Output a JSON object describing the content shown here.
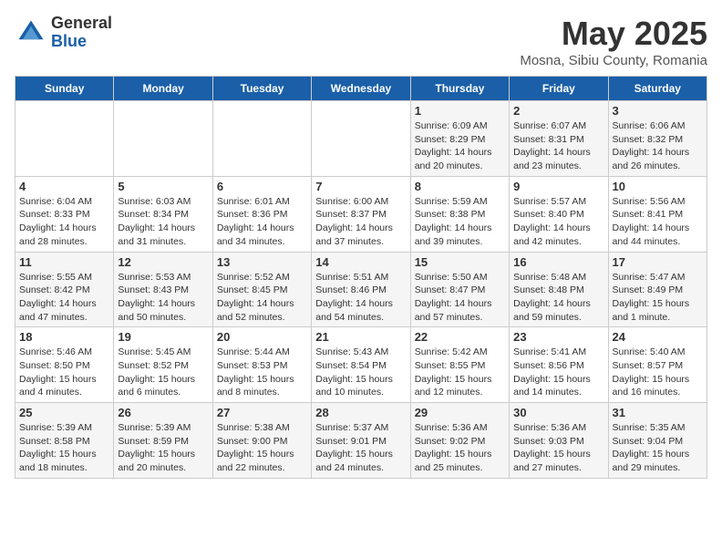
{
  "logo": {
    "general": "General",
    "blue": "Blue"
  },
  "title": "May 2025",
  "subtitle": "Mosna, Sibiu County, Romania",
  "days_of_week": [
    "Sunday",
    "Monday",
    "Tuesday",
    "Wednesday",
    "Thursday",
    "Friday",
    "Saturday"
  ],
  "weeks": [
    [
      {
        "day": "",
        "info": ""
      },
      {
        "day": "",
        "info": ""
      },
      {
        "day": "",
        "info": ""
      },
      {
        "day": "",
        "info": ""
      },
      {
        "day": "1",
        "info": "Sunrise: 6:09 AM\nSunset: 8:29 PM\nDaylight: 14 hours\nand 20 minutes."
      },
      {
        "day": "2",
        "info": "Sunrise: 6:07 AM\nSunset: 8:31 PM\nDaylight: 14 hours\nand 23 minutes."
      },
      {
        "day": "3",
        "info": "Sunrise: 6:06 AM\nSunset: 8:32 PM\nDaylight: 14 hours\nand 26 minutes."
      }
    ],
    [
      {
        "day": "4",
        "info": "Sunrise: 6:04 AM\nSunset: 8:33 PM\nDaylight: 14 hours\nand 28 minutes."
      },
      {
        "day": "5",
        "info": "Sunrise: 6:03 AM\nSunset: 8:34 PM\nDaylight: 14 hours\nand 31 minutes."
      },
      {
        "day": "6",
        "info": "Sunrise: 6:01 AM\nSunset: 8:36 PM\nDaylight: 14 hours\nand 34 minutes."
      },
      {
        "day": "7",
        "info": "Sunrise: 6:00 AM\nSunset: 8:37 PM\nDaylight: 14 hours\nand 37 minutes."
      },
      {
        "day": "8",
        "info": "Sunrise: 5:59 AM\nSunset: 8:38 PM\nDaylight: 14 hours\nand 39 minutes."
      },
      {
        "day": "9",
        "info": "Sunrise: 5:57 AM\nSunset: 8:40 PM\nDaylight: 14 hours\nand 42 minutes."
      },
      {
        "day": "10",
        "info": "Sunrise: 5:56 AM\nSunset: 8:41 PM\nDaylight: 14 hours\nand 44 minutes."
      }
    ],
    [
      {
        "day": "11",
        "info": "Sunrise: 5:55 AM\nSunset: 8:42 PM\nDaylight: 14 hours\nand 47 minutes."
      },
      {
        "day": "12",
        "info": "Sunrise: 5:53 AM\nSunset: 8:43 PM\nDaylight: 14 hours\nand 50 minutes."
      },
      {
        "day": "13",
        "info": "Sunrise: 5:52 AM\nSunset: 8:45 PM\nDaylight: 14 hours\nand 52 minutes."
      },
      {
        "day": "14",
        "info": "Sunrise: 5:51 AM\nSunset: 8:46 PM\nDaylight: 14 hours\nand 54 minutes."
      },
      {
        "day": "15",
        "info": "Sunrise: 5:50 AM\nSunset: 8:47 PM\nDaylight: 14 hours\nand 57 minutes."
      },
      {
        "day": "16",
        "info": "Sunrise: 5:48 AM\nSunset: 8:48 PM\nDaylight: 14 hours\nand 59 minutes."
      },
      {
        "day": "17",
        "info": "Sunrise: 5:47 AM\nSunset: 8:49 PM\nDaylight: 15 hours\nand 1 minute."
      }
    ],
    [
      {
        "day": "18",
        "info": "Sunrise: 5:46 AM\nSunset: 8:50 PM\nDaylight: 15 hours\nand 4 minutes."
      },
      {
        "day": "19",
        "info": "Sunrise: 5:45 AM\nSunset: 8:52 PM\nDaylight: 15 hours\nand 6 minutes."
      },
      {
        "day": "20",
        "info": "Sunrise: 5:44 AM\nSunset: 8:53 PM\nDaylight: 15 hours\nand 8 minutes."
      },
      {
        "day": "21",
        "info": "Sunrise: 5:43 AM\nSunset: 8:54 PM\nDaylight: 15 hours\nand 10 minutes."
      },
      {
        "day": "22",
        "info": "Sunrise: 5:42 AM\nSunset: 8:55 PM\nDaylight: 15 hours\nand 12 minutes."
      },
      {
        "day": "23",
        "info": "Sunrise: 5:41 AM\nSunset: 8:56 PM\nDaylight: 15 hours\nand 14 minutes."
      },
      {
        "day": "24",
        "info": "Sunrise: 5:40 AM\nSunset: 8:57 PM\nDaylight: 15 hours\nand 16 minutes."
      }
    ],
    [
      {
        "day": "25",
        "info": "Sunrise: 5:39 AM\nSunset: 8:58 PM\nDaylight: 15 hours\nand 18 minutes."
      },
      {
        "day": "26",
        "info": "Sunrise: 5:39 AM\nSunset: 8:59 PM\nDaylight: 15 hours\nand 20 minutes."
      },
      {
        "day": "27",
        "info": "Sunrise: 5:38 AM\nSunset: 9:00 PM\nDaylight: 15 hours\nand 22 minutes."
      },
      {
        "day": "28",
        "info": "Sunrise: 5:37 AM\nSunset: 9:01 PM\nDaylight: 15 hours\nand 24 minutes."
      },
      {
        "day": "29",
        "info": "Sunrise: 5:36 AM\nSunset: 9:02 PM\nDaylight: 15 hours\nand 25 minutes."
      },
      {
        "day": "30",
        "info": "Sunrise: 5:36 AM\nSunset: 9:03 PM\nDaylight: 15 hours\nand 27 minutes."
      },
      {
        "day": "31",
        "info": "Sunrise: 5:35 AM\nSunset: 9:04 PM\nDaylight: 15 hours\nand 29 minutes."
      }
    ]
  ]
}
